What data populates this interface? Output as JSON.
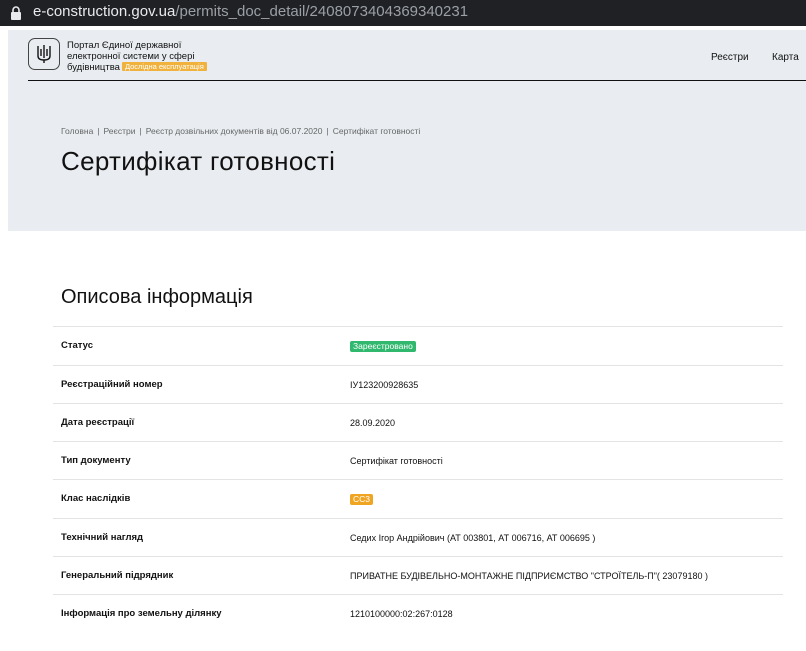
{
  "browser": {
    "url_domain": "e-construction.gov.ua",
    "url_path": "/permits_doc_detail/2408073404369340231",
    "lock_icon": "lock-icon"
  },
  "header": {
    "logo_icon": "trident-icon",
    "portal_line1": "Портал Єдиної державної",
    "portal_line2": "електронної системи у сфері",
    "portal_line3": "будівництва",
    "badge": "Дослідна експлуатація",
    "nav": [
      "Реєстри",
      "Карта"
    ]
  },
  "breadcrumbs": [
    "Головна",
    "Реєстри",
    "Реєстр дозвільних документів від 06.07.2020",
    "Сертифікат готовності"
  ],
  "page_title": "Сертифікат готовності",
  "section_title": "Описова інформація",
  "rows": [
    {
      "label": "Статус",
      "value": "Зареєстровано"
    },
    {
      "label": "Реєстраційний номер",
      "value": "ІУ123200928635"
    },
    {
      "label": "Дата реєстрації",
      "value": "28.09.2020"
    },
    {
      "label": "Тип документу",
      "value": "Сертифікат готовності"
    },
    {
      "label": "Клас наслідків",
      "value": "СС3"
    },
    {
      "label": "Технічний нагляд",
      "value": "Седих Ігор Андрійович (АТ 003801, АТ 006716, АТ 006695 )"
    },
    {
      "label": "Генеральний підрядник",
      "value": "ПРИВАТНЕ БУДІВЕЛЬНО-МОНТАЖНЕ ПІДПРИЄМСТВО \"СТРОЇТЕЛЬ-П\"( 23079180 )"
    },
    {
      "label": "Інформація про земельну ділянку",
      "value": "1210100000:02:267:0128"
    }
  ],
  "colors": {
    "status_badge": "#2fb86e",
    "class_badge": "#f0a522",
    "dev_badge": "#f0b23c",
    "hero_bg": "#e9edf1"
  }
}
